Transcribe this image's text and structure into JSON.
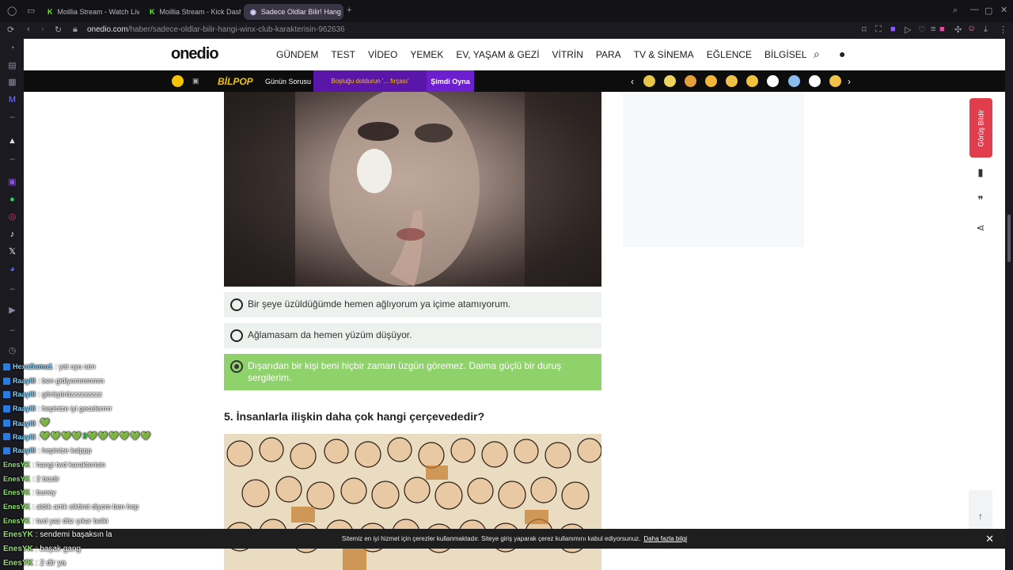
{
  "browser": {
    "tabs": [
      {
        "label": "Moillia Stream - Watch Liv",
        "favicon": "kick-icon",
        "active": false
      },
      {
        "label": "Moillia Stream - Kick Dash",
        "favicon": "kick-icon",
        "active": false
      },
      {
        "label": "Sadece Oldlar Bilir! Hang",
        "favicon": "onedio-icon",
        "active": true
      }
    ],
    "url_host": "onedio.com",
    "url_path": "/haber/sadece-oldlar-bilir-hangi-winx-club-karakterisin-962636"
  },
  "site": {
    "logo": "onedio",
    "nav": [
      "GÜNDEM",
      "TEST",
      "VİDEO",
      "YEMEK",
      "EV, YAŞAM & GEZİ",
      "VİTRİN",
      "PARA",
      "TV & SİNEMA",
      "EĞLENCE",
      "BİLGİSEL"
    ]
  },
  "promo_strip": {
    "brand": "BİLPOP",
    "daily_question": "Günün Sorusu",
    "prompt": "Boşluğu doldurun '... fırçası'",
    "play_button": "Şimdi Oyna"
  },
  "quiz": {
    "options": [
      {
        "text": "Bir şeye üzüldüğümde hemen ağlıyorum ya içime atamıyorum.",
        "selected": false
      },
      {
        "text": "Ağlamasam da hemen yüzüm düşüyor.",
        "selected": false
      },
      {
        "text": "Dışarıdan bir kişi beni hiçbir zaman üzgün göremez. Daima güçlü bir duruş sergilerim.",
        "selected": true
      }
    ],
    "next_question": "5. İnsanlarla ilişkin daha çok hangi çerçevededir?"
  },
  "sidebar_tools": {
    "feedback_label": "Görüş Bildir"
  },
  "cookie_banner": {
    "text": "Sitemiz en iyi hizmet için çerezler kullanmaktadır. Siteye giriş yaparak çerez kullanımını kabul ediyorsunuz.",
    "link": "Daha fazla bilgi"
  },
  "chat": [
    {
      "user": "HexaSama1",
      "msg": ": yat uyu sen",
      "badge": true
    },
    {
      "user": "Raaylli",
      "msg": ": ben gidiyommmmm",
      "badge": true
    },
    {
      "user": "Raaylli",
      "msg": ": görüşürüzzzzzzzzz",
      "badge": true
    },
    {
      "user": "Raaylli",
      "msg": ": hepinize iyi gecelerrrrr",
      "badge": true
    },
    {
      "user": "Raaylli",
      "msg": ":",
      "badge": true,
      "hearts": "💚"
    },
    {
      "user": "Raaylli",
      "msg": ":",
      "badge": true,
      "hearts": "💚💚💚💚3💚💚💚💚💚💚"
    },
    {
      "user": "Raaylli",
      "msg": ": hepinize kalppp",
      "badge": true
    },
    {
      "user": "EnesYK",
      "msg": ": hangi twd karakterisin",
      "badge": false
    },
    {
      "user": "EnesYK",
      "msg": ": 2 bizdir",
      "badge": false
    },
    {
      "user": "EnesYK",
      "msg": ": buney",
      "badge": false
    },
    {
      "user": "EnesYK",
      "msg": ": aldık artık siktiret diyom ben hep",
      "badge": false
    },
    {
      "user": "EnesYK",
      "msg": ": twd yaz düz çıkar belki",
      "badge": false
    },
    {
      "user": "EnesYK",
      "msg": ": sendemi başaksın la",
      "badge": false
    },
    {
      "user": "EnesYK",
      "msg": ": başak gang",
      "badge": false
    },
    {
      "user": "EnesYK",
      "msg": ": 2 dir ya",
      "badge": false
    }
  ],
  "colors": {
    "selected_option": "#8fd16a",
    "feedback": "#e23d4d",
    "chat_user_highlight": "#8fe36b",
    "chat_user_default": "#7fd4ff"
  }
}
